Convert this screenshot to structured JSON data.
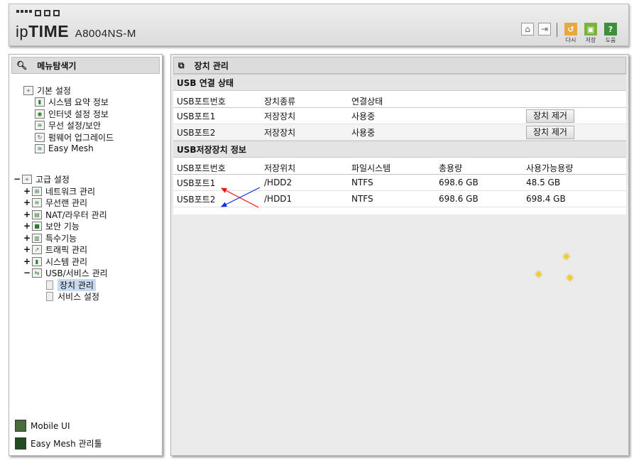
{
  "header": {
    "logo_prefix": "ip",
    "logo_bold": "TIME",
    "model": "A8004NS-M",
    "buttons": [
      {
        "label": "다시",
        "color": "#e8a83a",
        "icon": "refresh-icon"
      },
      {
        "label": "저장",
        "color": "#7bb33b",
        "icon": "save-icon"
      },
      {
        "label": "도움",
        "color": "#3c8f3c",
        "icon": "help-icon"
      }
    ]
  },
  "sidebar": {
    "title": "메뉴탐색기",
    "basic": {
      "label": "기본 설정",
      "items": [
        "시스템 요약 정보",
        "인터넷 설정 정보",
        "무선 설정/보안",
        "펌웨어 업그레이드",
        "Easy Mesh"
      ]
    },
    "advanced": {
      "label": "고급 설정",
      "items": [
        "네트워크 관리",
        "무선랜 관리",
        "NAT/라우터 관리",
        "보안 기능",
        "특수기능",
        "트래픽 관리",
        "시스템 관리",
        "USB/서비스 관리"
      ],
      "usb_children": [
        "장치 관리",
        "서비스 설정"
      ]
    },
    "bottom": [
      "Mobile UI",
      "Easy Mesh 관리툴"
    ]
  },
  "main": {
    "title": "장치 관리",
    "usb_status": {
      "heading": "USB 연결 상태",
      "columns": [
        "USB포트번호",
        "장치종류",
        "연결상태",
        ""
      ],
      "rows": [
        {
          "port": "USB포트1",
          "type": "저장장치",
          "status": "사용중",
          "button": "장치 제거"
        },
        {
          "port": "USB포트2",
          "type": "저장장치",
          "status": "사용중",
          "button": "장치 제거"
        }
      ]
    },
    "storage": {
      "heading": "USB저장장치 정보",
      "columns": [
        "USB포트번호",
        "저장위치",
        "파일시스템",
        "총용량",
        "사용가능용량"
      ],
      "rows": [
        {
          "port": "USB포트1",
          "location": "/HDD2",
          "fs": "NTFS",
          "total": "698.6 GB",
          "free": "48.5 GB"
        },
        {
          "port": "USB포트2",
          "location": "/HDD1",
          "fs": "NTFS",
          "total": "698.6 GB",
          "free": "698.4 GB"
        }
      ]
    }
  },
  "colors": {
    "arrow_red": "#ee1111",
    "arrow_blue": "#1133dd",
    "selection": "#c8daf0"
  }
}
